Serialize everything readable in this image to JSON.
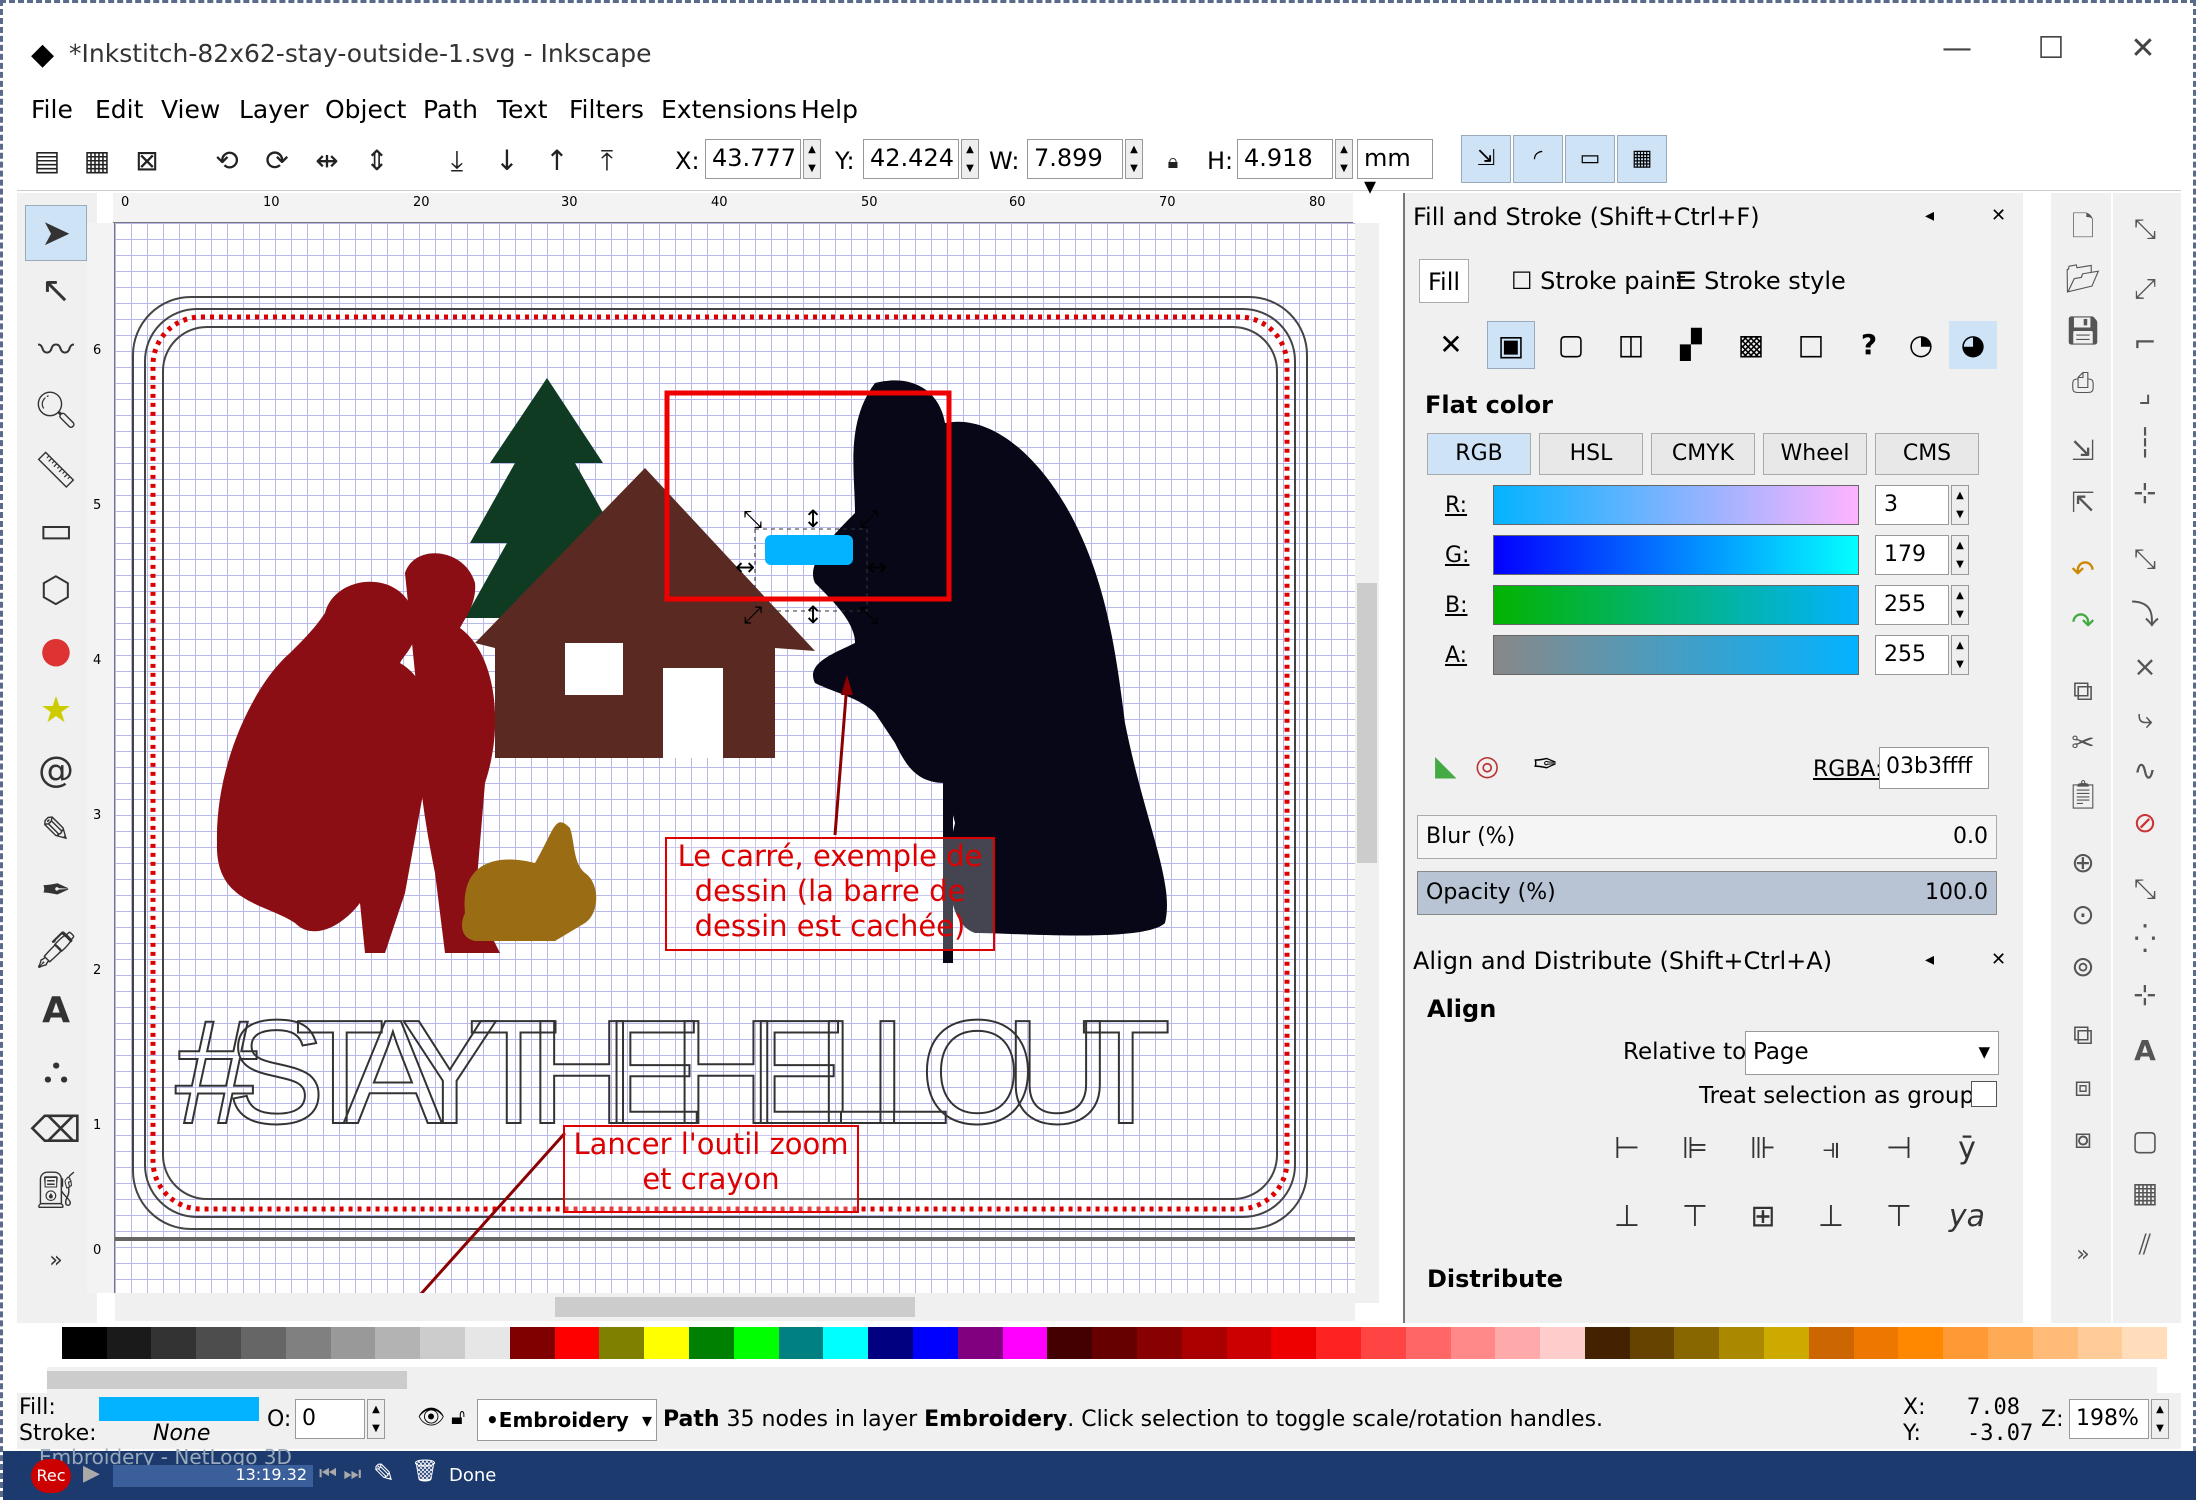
{
  "window": {
    "title": "*Inkstitch-82x62-stay-outside-1.svg - Inkscape",
    "min": "—",
    "max": "☐",
    "close": "✕"
  },
  "menu": [
    "File",
    "Edit",
    "View",
    "Layer",
    "Object",
    "Path",
    "Text",
    "Filters",
    "Extensions",
    "Help"
  ],
  "toolbar": {
    "x_label": "X:",
    "x_value": "43.777",
    "y_label": "Y:",
    "y_value": "42.424",
    "w_label": "W:",
    "w_value": "7.899",
    "h_label": "H:",
    "h_value": "4.918",
    "unit": "mm"
  },
  "canvas": {
    "text_art": "#STAYTHEHELLOUT",
    "annotation1": "Le carré, exemple de dessin (la barre de dessin est cachée)",
    "annotation2": "Lancer l'outil zoom et crayon",
    "ruler_h": [
      "0",
      "10",
      "20",
      "30",
      "40",
      "50",
      "60",
      "70",
      "80"
    ],
    "ruler_v": [
      "6",
      "5",
      "4",
      "3",
      "2",
      "1",
      "0"
    ]
  },
  "fill_stroke": {
    "title": "Fill and Stroke (Shift+Ctrl+F)",
    "tabs": [
      "Fill",
      "Stroke paint",
      "Stroke style"
    ],
    "flat_color": "Flat color",
    "modes": [
      "RGB",
      "HSL",
      "CMYK",
      "Wheel",
      "CMS"
    ],
    "r_label": "R:",
    "r_value": "3",
    "g_label": "G:",
    "g_value": "179",
    "b_label": "B:",
    "b_value": "255",
    "a_label": "A:",
    "a_value": "255",
    "rgba_label": "RGBA:",
    "rgba_value": "03b3ffff",
    "blur_label": "Blur (%)",
    "blur_value": "0.0",
    "opacity_label": "Opacity (%)",
    "opacity_value": "100.0"
  },
  "align": {
    "title": "Align and Distribute (Shift+Ctrl+A)",
    "section": "Align",
    "relative_label": "Relative to:",
    "relative_value": "Page",
    "treat_label": "Treat selection as group:",
    "distribute": "Distribute"
  },
  "status": {
    "fill_label": "Fill:",
    "stroke_label": "Stroke:",
    "stroke_value": "None",
    "o_label": "O:",
    "o_value": "0",
    "layer": "•Embroidery",
    "message_prefix": "Path",
    "message_rest": " 35 nodes in layer ",
    "message_layer": "Embroidery",
    "message_end": ". Click selection to toggle scale/rotation handles.",
    "x_label": "X:",
    "x_value": "7.08",
    "y_label": "Y:",
    "y_value": "-3.07",
    "z_label": "Z:",
    "zoom": "198%"
  },
  "recorder": {
    "rec": "Rec",
    "time": "13:19.32",
    "done": "Done",
    "bg_text": "Embroidery - NetLogo 3D"
  },
  "colors": {
    "fill": "#03b3ff",
    "accent": "#cfe3f7"
  }
}
